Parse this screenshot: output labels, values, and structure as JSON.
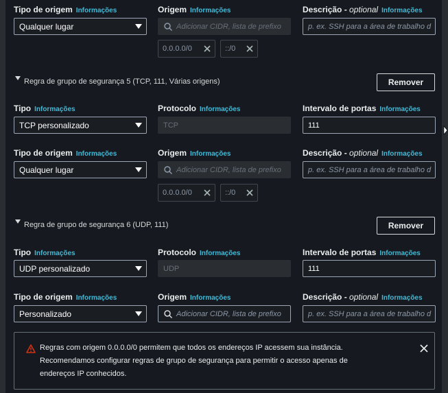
{
  "info_label": "Informações",
  "rule4": {
    "source_type_label": "Tipo de origem",
    "source_label": "Origem",
    "description_label": "Descrição - ",
    "description_label_em": "optional",
    "source_type_value": "Qualquer lugar",
    "source_placeholder": "Adicionar CIDR, lista de prefixo",
    "description_placeholder": "p. ex. SSH para a área de trabalho d",
    "tokens": [
      "0.0.0.0/0",
      "::/0"
    ]
  },
  "rule5": {
    "title": "Regra de grupo de segurança 5 (TCP, 111, Várias origens)",
    "remove_label": "Remover",
    "type_label": "Tipo",
    "protocol_label": "Protocolo",
    "port_label": "Intervalo de portas",
    "type_value": "TCP personalizado",
    "protocol_value": "TCP",
    "port_value": "111",
    "source_type_label": "Tipo de origem",
    "source_label": "Origem",
    "description_label": "Descrição - ",
    "description_label_em": "optional",
    "source_type_value": "Qualquer lugar",
    "source_placeholder": "Adicionar CIDR, lista de prefixo",
    "description_placeholder": "p. ex. SSH para a área de trabalho d",
    "tokens": [
      "0.0.0.0/0",
      "::/0"
    ]
  },
  "rule6": {
    "title": "Regra de grupo de segurança 6 (UDP, 111)",
    "remove_label": "Remover",
    "type_label": "Tipo",
    "protocol_label": "Protocolo",
    "port_label": "Intervalo de portas",
    "type_value": "UDP personalizado",
    "protocol_value": "UDP",
    "port_value": "111",
    "source_type_label": "Tipo de origem",
    "source_label": "Origem",
    "description_label": "Descrição - ",
    "description_label_em": "optional",
    "source_type_value": "Personalizado",
    "source_placeholder": "Adicionar CIDR, lista de prefixo",
    "description_placeholder": "p. ex. SSH para a área de trabalho d"
  },
  "alert": {
    "line1": "Regras com origem 0.0.0.0/0 permitem que todos os endereços IP acessem sua instância.",
    "line2": "Recomendamos configurar regras de grupo de segurança para permitir o acesso apenas de",
    "line3": "endereços IP conhecidos."
  },
  "colors": {
    "accent_link": "#44b9d6",
    "warning": "#d13212",
    "background": "#16191f"
  }
}
